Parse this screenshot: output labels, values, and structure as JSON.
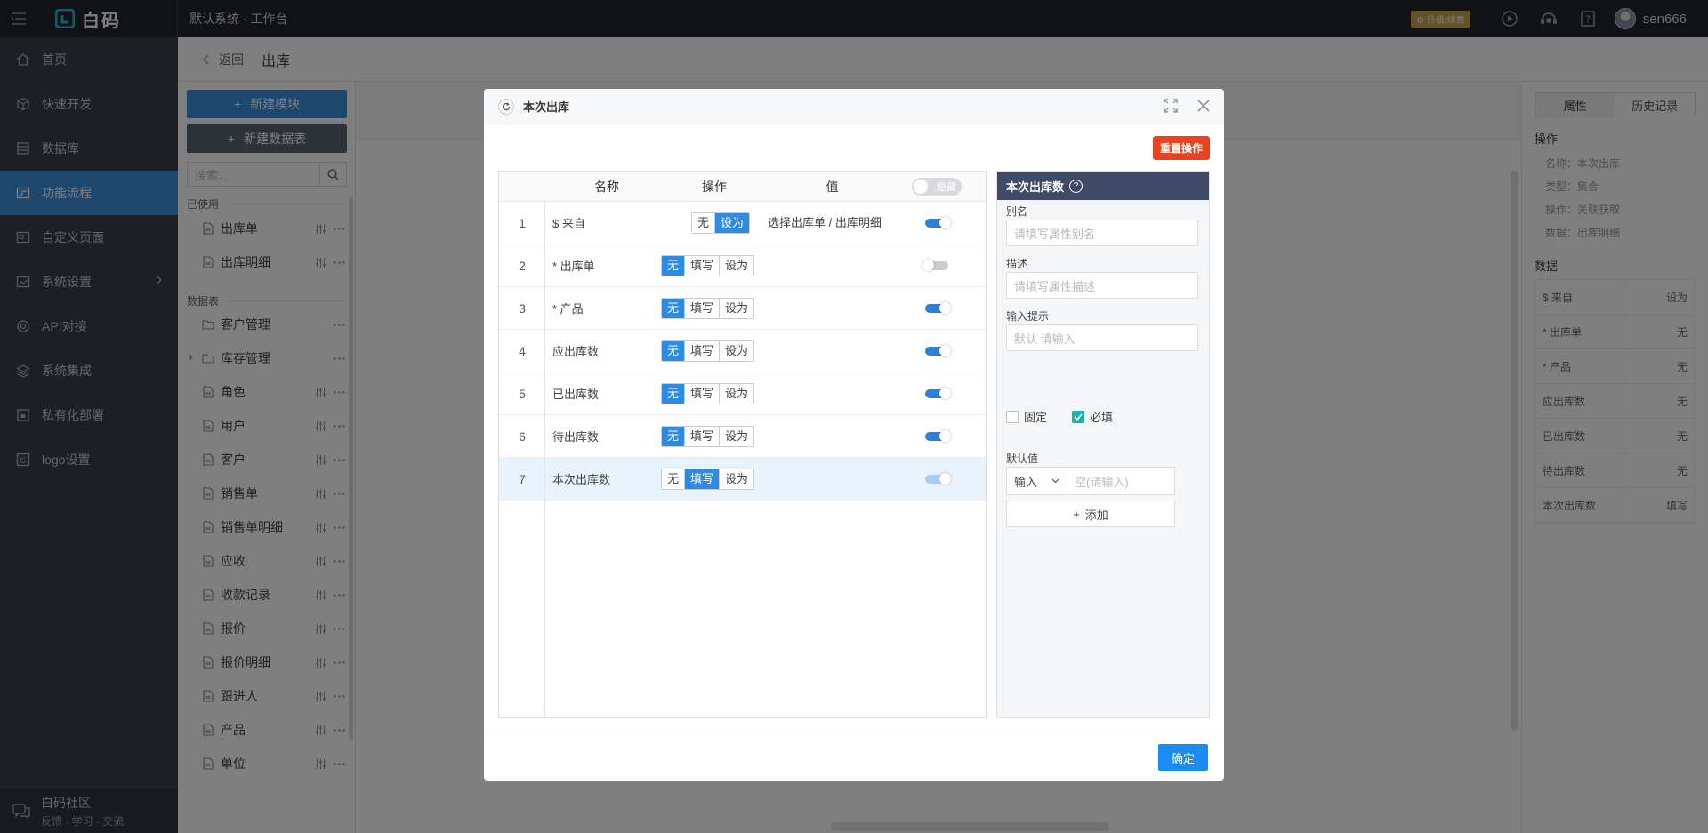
{
  "topbar": {
    "logo_text": "白码",
    "system_title": "默认系统 · 工作台",
    "upgrade_label": "升级/续费",
    "username": "sen666"
  },
  "nav": {
    "items": [
      {
        "label": "首页",
        "icon": "home-icon"
      },
      {
        "label": "快速开发",
        "icon": "cube-icon"
      },
      {
        "label": "数据库",
        "icon": "database-icon"
      },
      {
        "label": "功能流程",
        "icon": "flow-icon",
        "active": true
      },
      {
        "label": "自定义页面",
        "icon": "page-icon"
      },
      {
        "label": "系统设置",
        "icon": "chart-icon"
      },
      {
        "label": "API对接",
        "icon": "api-icon"
      },
      {
        "label": "系统集成",
        "icon": "layers-icon"
      },
      {
        "label": "私有化部署",
        "icon": "lock-icon"
      },
      {
        "label": "logo设置",
        "icon": "logo-icon"
      }
    ],
    "community_title": "白码社区",
    "community_sub": "反馈 · 学习 · 交流"
  },
  "breadcrumb": {
    "back": "返回",
    "title": "出库"
  },
  "modules": {
    "new_module": "新建模块",
    "new_table": "新建数据表",
    "search_placeholder": "搜索...",
    "used_title": "已使用",
    "used": [
      "出库单",
      "出库明细"
    ],
    "tables_title": "数据表",
    "tables": [
      {
        "label": "客户管理",
        "type": "folder"
      },
      {
        "label": "库存管理",
        "type": "folder",
        "caret": true
      },
      {
        "label": "角色",
        "type": "table"
      },
      {
        "label": "用户",
        "type": "table"
      },
      {
        "label": "客户",
        "type": "table"
      },
      {
        "label": "销售单",
        "type": "table"
      },
      {
        "label": "销售单明细",
        "type": "table"
      },
      {
        "label": "应收",
        "type": "table"
      },
      {
        "label": "收款记录",
        "type": "table"
      },
      {
        "label": "报价",
        "type": "table"
      },
      {
        "label": "报价明细",
        "type": "table"
      },
      {
        "label": "跟进人",
        "type": "table"
      },
      {
        "label": "产品",
        "type": "table"
      },
      {
        "label": "单位",
        "type": "table"
      }
    ]
  },
  "props": {
    "tab_attr": "属性",
    "tab_history": "历史记录",
    "op_title": "操作",
    "op_info": [
      "名称：本次出库",
      "类型：集合",
      "操作：关联获取",
      "数据：出库明细"
    ],
    "data_title": "数据",
    "data_rows": [
      {
        "k": "$ 来自",
        "v": "设为"
      },
      {
        "k": "* 出库单",
        "v": "无"
      },
      {
        "k": "* 产品",
        "v": "无"
      },
      {
        "k": "应出库数",
        "v": "无"
      },
      {
        "k": "已出库数",
        "v": "无"
      },
      {
        "k": "待出库数",
        "v": "无"
      },
      {
        "k": "本次出库数",
        "v": "填写"
      }
    ]
  },
  "modal": {
    "title": "本次出库",
    "reset_label": "重置操作",
    "headers": {
      "name": "名称",
      "op": "操作",
      "value": "值",
      "hide": "隐藏"
    },
    "op_labels": {
      "none": "无",
      "fill": "填写",
      "set": "设为"
    },
    "rows": [
      {
        "no": "1",
        "name": "$ 来自",
        "ops": [
          "none",
          "set"
        ],
        "selected_op": "set",
        "value": "选择出库单 / 出库明细",
        "switch": "on"
      },
      {
        "no": "2",
        "name": "* 出库单",
        "ops": [
          "none",
          "fill",
          "set"
        ],
        "selected_op": "none",
        "value": "",
        "switch": "off"
      },
      {
        "no": "3",
        "name": "* 产品",
        "ops": [
          "none",
          "fill",
          "set"
        ],
        "selected_op": "none",
        "value": "",
        "switch": "on"
      },
      {
        "no": "4",
        "name": "应出库数",
        "ops": [
          "none",
          "fill",
          "set"
        ],
        "selected_op": "none",
        "value": "",
        "switch": "on"
      },
      {
        "no": "5",
        "name": "已出库数",
        "ops": [
          "none",
          "fill",
          "set"
        ],
        "selected_op": "none",
        "value": "",
        "switch": "on"
      },
      {
        "no": "6",
        "name": "待出库数",
        "ops": [
          "none",
          "fill",
          "set"
        ],
        "selected_op": "none",
        "value": "",
        "switch": "on"
      },
      {
        "no": "7",
        "name": "本次出库数",
        "ops": [
          "none",
          "fill",
          "set"
        ],
        "selected_op": "fill",
        "value": "",
        "switch": "dim",
        "selected": true
      }
    ],
    "attr": {
      "title": "本次出库数",
      "alias_label": "别名",
      "alias_placeholder": "请填写属性别名",
      "desc_label": "描述",
      "desc_placeholder": "请填写属性描述",
      "hint_label": "输入提示",
      "hint_placeholder": "默认 请输入",
      "fixed_label": "固定",
      "fixed_checked": false,
      "required_label": "必填",
      "required_checked": true,
      "default_label": "默认值",
      "default_mode": "输入",
      "default_placeholder": "空(请输入)",
      "add_label": "添加"
    },
    "ok_label": "确定"
  }
}
